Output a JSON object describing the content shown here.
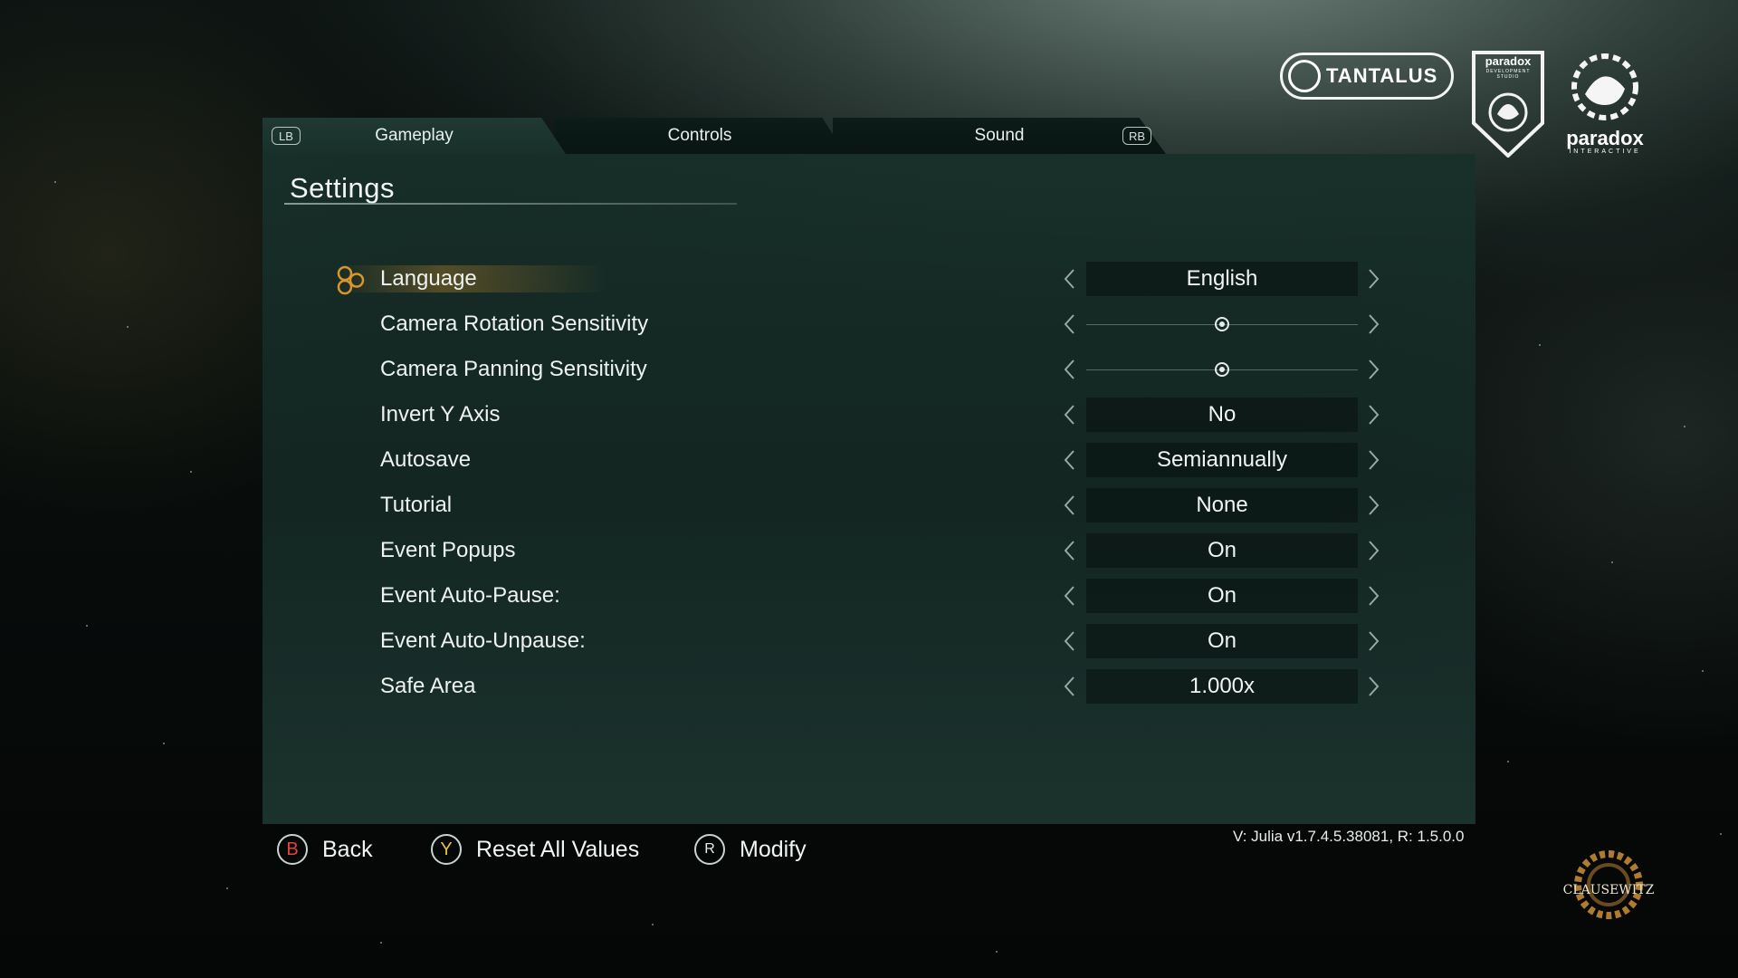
{
  "tabs": [
    {
      "label": "Gameplay",
      "active": true
    },
    {
      "label": "Controls",
      "active": false
    },
    {
      "label": "Sound",
      "active": false
    }
  ],
  "shoulders": {
    "left": "LB",
    "right": "RB"
  },
  "panel": {
    "title": "Settings"
  },
  "settings": [
    {
      "label": "Language",
      "type": "option",
      "value": "English",
      "selected": true
    },
    {
      "label": "Camera Rotation Sensitivity",
      "type": "slider",
      "level": 0.5
    },
    {
      "label": "Camera Panning Sensitivity",
      "type": "slider",
      "level": 0.5
    },
    {
      "label": "Invert Y Axis",
      "type": "option",
      "value": "No"
    },
    {
      "label": "Autosave",
      "type": "option",
      "value": "Semiannually"
    },
    {
      "label": "Tutorial",
      "type": "option",
      "value": "None"
    },
    {
      "label": "Event Popups",
      "type": "option",
      "value": "On"
    },
    {
      "label": "Event Auto-Pause:",
      "type": "option",
      "value": "On"
    },
    {
      "label": "Event Auto-Unpause:",
      "type": "option",
      "value": "On"
    },
    {
      "label": "Safe Area",
      "type": "option",
      "value": "1.000x"
    }
  ],
  "bottom": {
    "back": {
      "glyph": "B",
      "label": "Back",
      "color": "#e0443a"
    },
    "reset": {
      "glyph": "Y",
      "label": "Reset All Values",
      "color": "#e8c040"
    },
    "modify": {
      "glyph": "R",
      "label": "Modify",
      "color": "#e6ecea"
    }
  },
  "version": "V: Julia v1.7.4.5.38081, R: 1.5.0.0",
  "logos": {
    "tantalus": "TANTALUS",
    "pds_top": "paradox",
    "pds_sub": "DEVELOPMENT STUDIO",
    "paradox": "paradox",
    "paradox_sub": "INTERACTIVE",
    "clausewitz": "CLAUSEWITZ"
  },
  "colors": {
    "panel": "#183029",
    "accent": "#d9952e",
    "text": "#eef2f0"
  }
}
